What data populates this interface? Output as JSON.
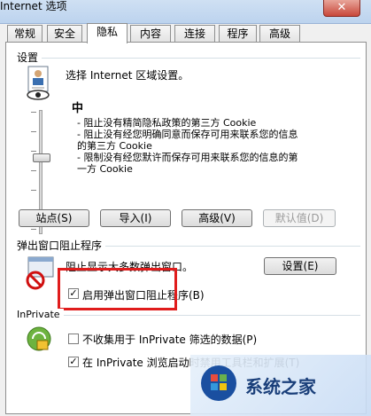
{
  "window": {
    "title": "Internet 选项",
    "close_glyph": "✕"
  },
  "tabs": [
    "常规",
    "安全",
    "隐私",
    "内容",
    "连接",
    "程序",
    "高级"
  ],
  "settings": {
    "group_label": "设置",
    "zone_text": "选择 Internet 区域设置。",
    "level": "中",
    "desc1": "- 阻止没有精简隐私政策的第三方 Cookie",
    "desc2": "- 阻止没有经您明确同意而保存可用来联系您的信息的第三方 Cookie",
    "desc3": "- 限制没有经您默许而保存可用来联系您的信息的第一方 Cookie"
  },
  "buttons": {
    "sites": "站点(S)",
    "import": "导入(I)",
    "advanced": "高级(V)",
    "default": "默认值(D)"
  },
  "popup": {
    "group_label": "弹出窗口阻止程序",
    "desc": "阻止显示大多数弹出窗口。",
    "settings_button": "设置(E)",
    "enable_label": "启用弹出窗口阻止程序(B)"
  },
  "inprivate": {
    "group_label": "InPrivate",
    "no_collect_label": "不收集用于 InPrivate 筛选的数据(P)",
    "disable_label": "在 InPrivate 浏览启动时禁用工具栏和扩展(T)"
  },
  "watermark": {
    "text": "系统之家"
  },
  "colors": {
    "highlight_box": "#e01c1c"
  }
}
